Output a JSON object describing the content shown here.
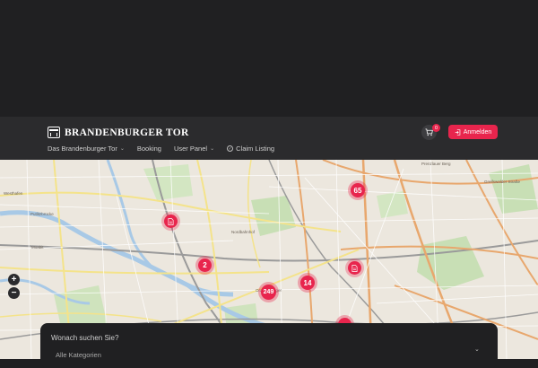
{
  "header": {
    "logo_text": "BRANDENBURGER TOR",
    "nav": [
      {
        "label": "Das Brandenburger Tor",
        "has_dropdown": true
      },
      {
        "label": "Booking",
        "has_dropdown": false
      },
      {
        "label": "User Panel",
        "has_dropdown": true
      },
      {
        "label": "Claim Listing",
        "has_dropdown": false
      }
    ],
    "cart_count": "0",
    "login_label": "Anmelden"
  },
  "map": {
    "zoom_in": "+",
    "zoom_out": "−",
    "clusters": [
      "65",
      "2",
      "14",
      "249"
    ],
    "labels": [
      "Westhafen",
      "Putlitzbrücke",
      "Moabit",
      "Nordbahnhof",
      "Prenzlauer Berg",
      "Greifswalder Straße",
      "Oranienburger"
    ]
  },
  "search": {
    "placeholder": "Wonach suchen Sie?",
    "category": "Alle Kategorien"
  },
  "colors": {
    "accent": "#e8254d",
    "dark": "#202022",
    "header": "#2b2b2d"
  }
}
